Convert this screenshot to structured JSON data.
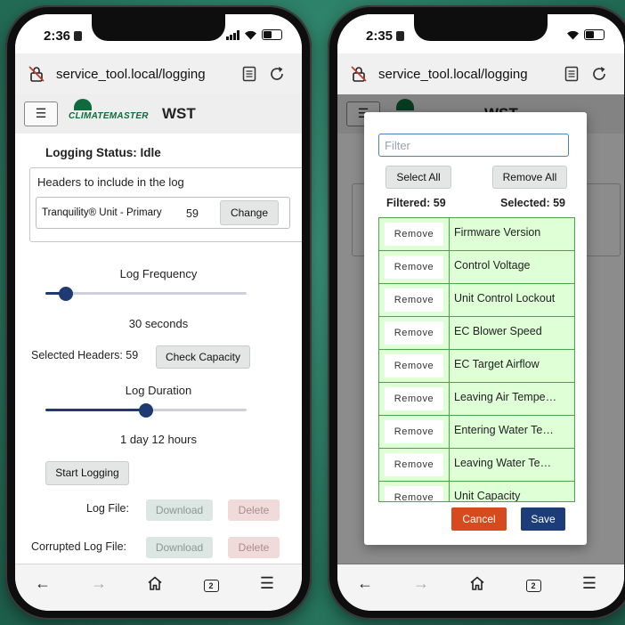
{
  "left_phone": {
    "status_time": "2:36",
    "url": "service_tool.local/logging",
    "app": {
      "brand": "CLIMATEMASTER",
      "title": "WST"
    },
    "logging_status": "Logging Status: Idle",
    "headers_box": {
      "label": "Headers to include in the log",
      "unit": "Tranquility® Unit - Primary",
      "count": "59",
      "change_label": "Change"
    },
    "log_frequency": {
      "label": "Log Frequency",
      "value_text": "30 seconds",
      "slider_fraction": 0.1
    },
    "selected_headers": {
      "text": "Selected Headers: 59",
      "button": "Check Capacity"
    },
    "log_duration": {
      "label": "Log Duration",
      "value_text": "1 day 12 hours",
      "slider_fraction": 0.5
    },
    "start_logging": "Start Logging",
    "log_file": {
      "label": "Log File:",
      "download": "Download",
      "delete": "Delete"
    },
    "corrupted_log_file": {
      "label": "Corrupted Log File:",
      "download": "Download",
      "delete": "Delete"
    },
    "nav": {
      "tabs_count": "2"
    }
  },
  "right_phone": {
    "status_time": "2:35",
    "url": "service_tool.local/logging",
    "app": {
      "title": "WST"
    },
    "modal": {
      "filter_placeholder": "Filter",
      "select_all": "Select All",
      "remove_all": "Remove All",
      "filtered": "Filtered: 59",
      "selected": "Selected: 59",
      "rows": [
        {
          "button": "Remove",
          "name": "Firmware Version"
        },
        {
          "button": "Remove",
          "name": "Control Voltage"
        },
        {
          "button": "Remove",
          "name": "Unit Control Lockout"
        },
        {
          "button": "Remove",
          "name": "EC Blower Speed"
        },
        {
          "button": "Remove",
          "name": "EC Target Airflow"
        },
        {
          "button": "Remove",
          "name": "Leaving Air Tempe…"
        },
        {
          "button": "Remove",
          "name": "Entering Water Te…"
        },
        {
          "button": "Remove",
          "name": "Leaving Water Te…"
        },
        {
          "button": "Remove",
          "name": "Unit Capacity"
        }
      ],
      "cancel": "Cancel",
      "save": "Save"
    },
    "nav": {
      "tabs_count": "2"
    }
  },
  "colors": {
    "accent_navy": "#1f3a73",
    "brand_green": "#0f6b3d",
    "row_green": "#dfffd7",
    "cancel_orange": "#d64a1d",
    "save_navy": "#1c3d7a",
    "background_teal": "#2b7d64"
  }
}
